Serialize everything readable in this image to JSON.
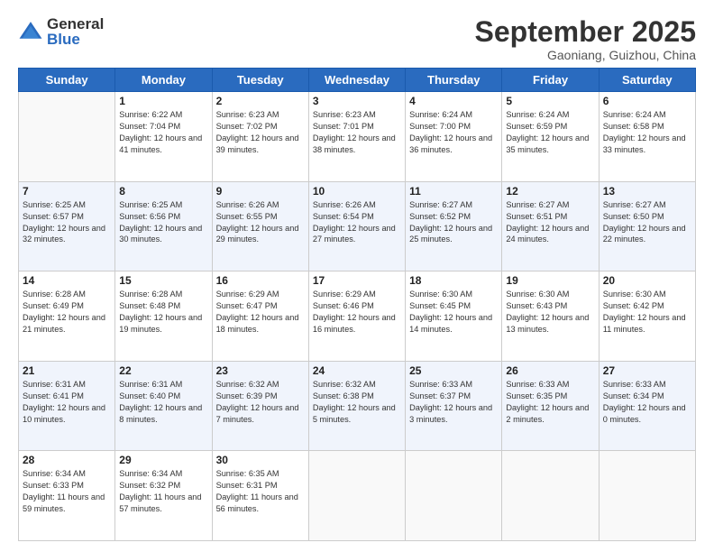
{
  "logo": {
    "general": "General",
    "blue": "Blue"
  },
  "header": {
    "month": "September 2025",
    "location": "Gaoniang, Guizhou, China"
  },
  "days_of_week": [
    "Sunday",
    "Monday",
    "Tuesday",
    "Wednesday",
    "Thursday",
    "Friday",
    "Saturday"
  ],
  "weeks": [
    [
      {
        "day": "",
        "empty": true
      },
      {
        "day": "1",
        "sunrise": "Sunrise: 6:22 AM",
        "sunset": "Sunset: 7:04 PM",
        "daylight": "Daylight: 12 hours and 41 minutes."
      },
      {
        "day": "2",
        "sunrise": "Sunrise: 6:23 AM",
        "sunset": "Sunset: 7:02 PM",
        "daylight": "Daylight: 12 hours and 39 minutes."
      },
      {
        "day": "3",
        "sunrise": "Sunrise: 6:23 AM",
        "sunset": "Sunset: 7:01 PM",
        "daylight": "Daylight: 12 hours and 38 minutes."
      },
      {
        "day": "4",
        "sunrise": "Sunrise: 6:24 AM",
        "sunset": "Sunset: 7:00 PM",
        "daylight": "Daylight: 12 hours and 36 minutes."
      },
      {
        "day": "5",
        "sunrise": "Sunrise: 6:24 AM",
        "sunset": "Sunset: 6:59 PM",
        "daylight": "Daylight: 12 hours and 35 minutes."
      },
      {
        "day": "6",
        "sunrise": "Sunrise: 6:24 AM",
        "sunset": "Sunset: 6:58 PM",
        "daylight": "Daylight: 12 hours and 33 minutes."
      }
    ],
    [
      {
        "day": "7",
        "sunrise": "Sunrise: 6:25 AM",
        "sunset": "Sunset: 6:57 PM",
        "daylight": "Daylight: 12 hours and 32 minutes."
      },
      {
        "day": "8",
        "sunrise": "Sunrise: 6:25 AM",
        "sunset": "Sunset: 6:56 PM",
        "daylight": "Daylight: 12 hours and 30 minutes."
      },
      {
        "day": "9",
        "sunrise": "Sunrise: 6:26 AM",
        "sunset": "Sunset: 6:55 PM",
        "daylight": "Daylight: 12 hours and 29 minutes."
      },
      {
        "day": "10",
        "sunrise": "Sunrise: 6:26 AM",
        "sunset": "Sunset: 6:54 PM",
        "daylight": "Daylight: 12 hours and 27 minutes."
      },
      {
        "day": "11",
        "sunrise": "Sunrise: 6:27 AM",
        "sunset": "Sunset: 6:52 PM",
        "daylight": "Daylight: 12 hours and 25 minutes."
      },
      {
        "day": "12",
        "sunrise": "Sunrise: 6:27 AM",
        "sunset": "Sunset: 6:51 PM",
        "daylight": "Daylight: 12 hours and 24 minutes."
      },
      {
        "day": "13",
        "sunrise": "Sunrise: 6:27 AM",
        "sunset": "Sunset: 6:50 PM",
        "daylight": "Daylight: 12 hours and 22 minutes."
      }
    ],
    [
      {
        "day": "14",
        "sunrise": "Sunrise: 6:28 AM",
        "sunset": "Sunset: 6:49 PM",
        "daylight": "Daylight: 12 hours and 21 minutes."
      },
      {
        "day": "15",
        "sunrise": "Sunrise: 6:28 AM",
        "sunset": "Sunset: 6:48 PM",
        "daylight": "Daylight: 12 hours and 19 minutes."
      },
      {
        "day": "16",
        "sunrise": "Sunrise: 6:29 AM",
        "sunset": "Sunset: 6:47 PM",
        "daylight": "Daylight: 12 hours and 18 minutes."
      },
      {
        "day": "17",
        "sunrise": "Sunrise: 6:29 AM",
        "sunset": "Sunset: 6:46 PM",
        "daylight": "Daylight: 12 hours and 16 minutes."
      },
      {
        "day": "18",
        "sunrise": "Sunrise: 6:30 AM",
        "sunset": "Sunset: 6:45 PM",
        "daylight": "Daylight: 12 hours and 14 minutes."
      },
      {
        "day": "19",
        "sunrise": "Sunrise: 6:30 AM",
        "sunset": "Sunset: 6:43 PM",
        "daylight": "Daylight: 12 hours and 13 minutes."
      },
      {
        "day": "20",
        "sunrise": "Sunrise: 6:30 AM",
        "sunset": "Sunset: 6:42 PM",
        "daylight": "Daylight: 12 hours and 11 minutes."
      }
    ],
    [
      {
        "day": "21",
        "sunrise": "Sunrise: 6:31 AM",
        "sunset": "Sunset: 6:41 PM",
        "daylight": "Daylight: 12 hours and 10 minutes."
      },
      {
        "day": "22",
        "sunrise": "Sunrise: 6:31 AM",
        "sunset": "Sunset: 6:40 PM",
        "daylight": "Daylight: 12 hours and 8 minutes."
      },
      {
        "day": "23",
        "sunrise": "Sunrise: 6:32 AM",
        "sunset": "Sunset: 6:39 PM",
        "daylight": "Daylight: 12 hours and 7 minutes."
      },
      {
        "day": "24",
        "sunrise": "Sunrise: 6:32 AM",
        "sunset": "Sunset: 6:38 PM",
        "daylight": "Daylight: 12 hours and 5 minutes."
      },
      {
        "day": "25",
        "sunrise": "Sunrise: 6:33 AM",
        "sunset": "Sunset: 6:37 PM",
        "daylight": "Daylight: 12 hours and 3 minutes."
      },
      {
        "day": "26",
        "sunrise": "Sunrise: 6:33 AM",
        "sunset": "Sunset: 6:35 PM",
        "daylight": "Daylight: 12 hours and 2 minutes."
      },
      {
        "day": "27",
        "sunrise": "Sunrise: 6:33 AM",
        "sunset": "Sunset: 6:34 PM",
        "daylight": "Daylight: 12 hours and 0 minutes."
      }
    ],
    [
      {
        "day": "28",
        "sunrise": "Sunrise: 6:34 AM",
        "sunset": "Sunset: 6:33 PM",
        "daylight": "Daylight: 11 hours and 59 minutes."
      },
      {
        "day": "29",
        "sunrise": "Sunrise: 6:34 AM",
        "sunset": "Sunset: 6:32 PM",
        "daylight": "Daylight: 11 hours and 57 minutes."
      },
      {
        "day": "30",
        "sunrise": "Sunrise: 6:35 AM",
        "sunset": "Sunset: 6:31 PM",
        "daylight": "Daylight: 11 hours and 56 minutes."
      },
      {
        "day": "",
        "empty": true
      },
      {
        "day": "",
        "empty": true
      },
      {
        "day": "",
        "empty": true
      },
      {
        "day": "",
        "empty": true
      }
    ]
  ]
}
